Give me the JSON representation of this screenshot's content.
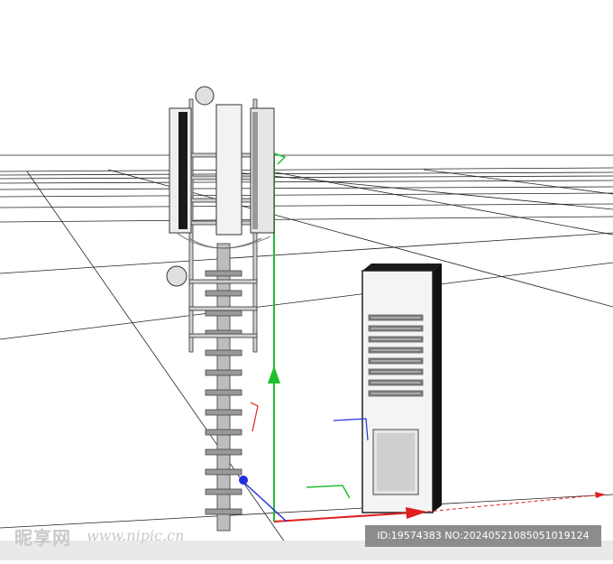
{
  "scene": {
    "description_icons": [
      "cell-tower-icon",
      "equipment-cabinet-icon",
      "axis-gizmo-icon"
    ],
    "colors": {
      "background": "#ffffff",
      "grid": "#222222",
      "axis_y": "#1fbf2f",
      "axis_x": "#e02020",
      "axis_z": "#2030e0",
      "metal": "#c8c8c8",
      "dark_metal": "#2a2a2a"
    }
  },
  "watermark": {
    "logo": "昵享网",
    "url": "www.nipic.cn"
  },
  "footer": {
    "id_text": "ID:19574383 NO:20240521085051019124"
  }
}
